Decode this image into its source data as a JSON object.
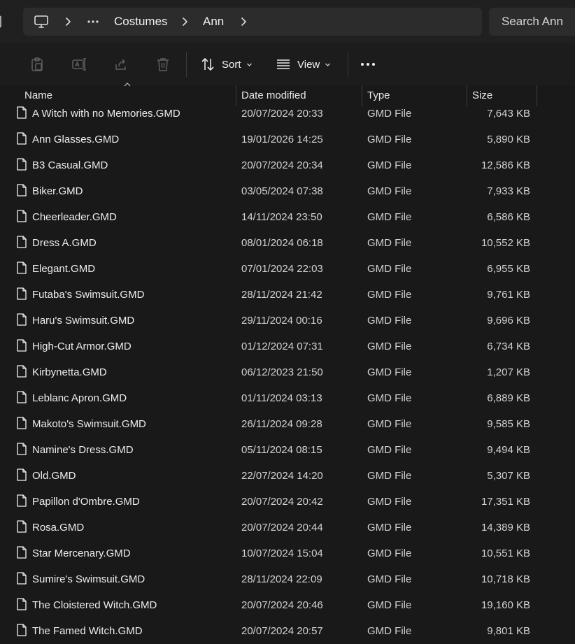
{
  "address_bar": {
    "breadcrumb": [
      "Costumes",
      "Ann"
    ],
    "search_placeholder": "Search Ann"
  },
  "toolbar": {
    "sort_label": "Sort",
    "view_label": "View"
  },
  "columns": {
    "name": "Name",
    "date": "Date modified",
    "type": "Type",
    "size": "Size"
  },
  "files": [
    {
      "name": "A Witch with no Memories.GMD",
      "date": "20/07/2024 20:33",
      "type": "GMD File",
      "size": "7,643 KB"
    },
    {
      "name": "Ann Glasses.GMD",
      "date": "19/01/2026 14:25",
      "type": "GMD File",
      "size": "5,890 KB"
    },
    {
      "name": "B3 Casual.GMD",
      "date": "20/07/2024 20:34",
      "type": "GMD File",
      "size": "12,586 KB"
    },
    {
      "name": "Biker.GMD",
      "date": "03/05/2024 07:38",
      "type": "GMD File",
      "size": "7,933 KB"
    },
    {
      "name": "Cheerleader.GMD",
      "date": "14/11/2024 23:50",
      "type": "GMD File",
      "size": "6,586 KB"
    },
    {
      "name": "Dress A.GMD",
      "date": "08/01/2024 06:18",
      "type": "GMD File",
      "size": "10,552 KB"
    },
    {
      "name": "Elegant.GMD",
      "date": "07/01/2024 22:03",
      "type": "GMD File",
      "size": "6,955 KB"
    },
    {
      "name": "Futaba's Swimsuit.GMD",
      "date": "28/11/2024 21:42",
      "type": "GMD File",
      "size": "9,761 KB"
    },
    {
      "name": "Haru's Swimsuit.GMD",
      "date": "29/11/2024 00:16",
      "type": "GMD File",
      "size": "9,696 KB"
    },
    {
      "name": "High-Cut Armor.GMD",
      "date": "01/12/2024 07:31",
      "type": "GMD File",
      "size": "6,734 KB"
    },
    {
      "name": "Kirbynetta.GMD",
      "date": "06/12/2023 21:50",
      "type": "GMD File",
      "size": "1,207 KB"
    },
    {
      "name": "Leblanc Apron.GMD",
      "date": "01/11/2024 03:13",
      "type": "GMD File",
      "size": "6,889 KB"
    },
    {
      "name": "Makoto's Swimsuit.GMD",
      "date": "26/11/2024 09:28",
      "type": "GMD File",
      "size": "9,585 KB"
    },
    {
      "name": "Namine's Dress.GMD",
      "date": "05/11/2024 08:15",
      "type": "GMD File",
      "size": "9,494 KB"
    },
    {
      "name": "Old.GMD",
      "date": "22/07/2024 14:20",
      "type": "GMD File",
      "size": "5,307 KB"
    },
    {
      "name": "Papillon d'Ombre.GMD",
      "date": "20/07/2024 20:42",
      "type": "GMD File",
      "size": "17,351 KB"
    },
    {
      "name": "Rosa.GMD",
      "date": "20/07/2024 20:44",
      "type": "GMD File",
      "size": "14,389 KB"
    },
    {
      "name": "Star Mercenary.GMD",
      "date": "10/07/2024 15:04",
      "type": "GMD File",
      "size": "10,551 KB"
    },
    {
      "name": "Sumire's Swimsuit.GMD",
      "date": "28/11/2024 22:09",
      "type": "GMD File",
      "size": "10,718 KB"
    },
    {
      "name": "The Cloistered Witch.GMD",
      "date": "20/07/2024 20:46",
      "type": "GMD File",
      "size": "19,160 KB"
    },
    {
      "name": "The Famed Witch.GMD",
      "date": "20/07/2024 20:57",
      "type": "GMD File",
      "size": "9,801 KB"
    }
  ],
  "icons": {
    "computer": "monitor-icon",
    "more_locations": "ellipsis-icon",
    "separator": "chevron-right-icon",
    "paste": "clipboard-icon",
    "rename": "rename-icon",
    "share": "share-icon",
    "delete": "trash-icon",
    "sort": "sort-icon",
    "view": "view-list-icon",
    "more": "more-icon",
    "file": "file-icon"
  },
  "colors": {
    "background": "#191919",
    "topbar": "#202020",
    "field": "#2c2c2c",
    "disabled_icon": "#5f5f5f"
  }
}
